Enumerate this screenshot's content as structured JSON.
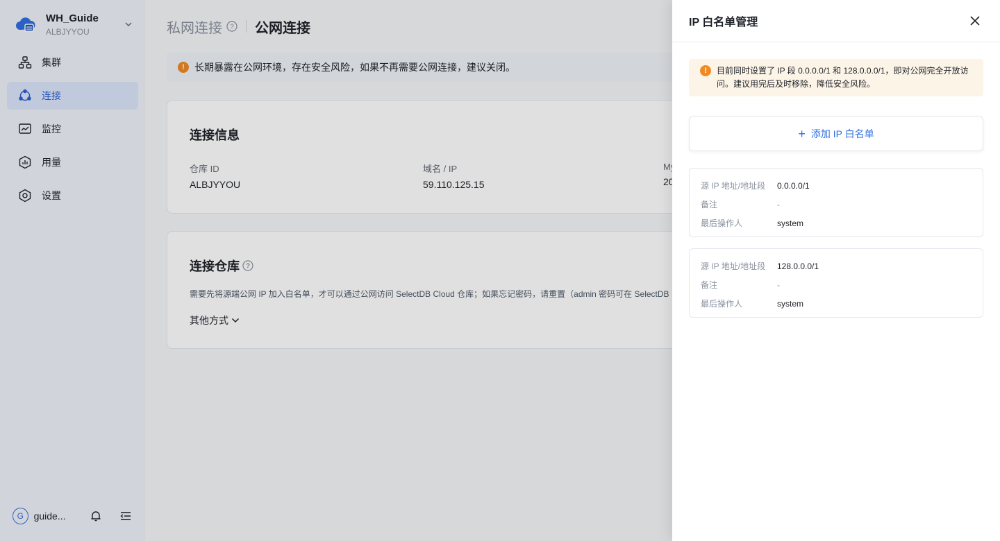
{
  "org": {
    "name": "WH_Guide",
    "id": "ALBJYYOU"
  },
  "nav": [
    {
      "label": "集群",
      "icon": "cluster-icon",
      "active": false
    },
    {
      "label": "连接",
      "icon": "connection-icon",
      "active": true
    },
    {
      "label": "监控",
      "icon": "monitor-icon",
      "active": false
    },
    {
      "label": "用量",
      "icon": "usage-icon",
      "active": false
    },
    {
      "label": "设置",
      "icon": "settings-icon",
      "active": false
    }
  ],
  "user": {
    "initial": "G",
    "name": "guide..."
  },
  "tabs": {
    "private": "私网连接",
    "public": "公网连接"
  },
  "alert": "长期暴露在公网环境，存在安全风险，如果不再需要公网连接，建议关闭。",
  "info_card": {
    "title": "连接信息",
    "fields": [
      {
        "label": "仓库 ID",
        "value": "ALBJYYOU"
      },
      {
        "label": "域名 / IP",
        "value": "59.110.125.15"
      },
      {
        "label": "My",
        "value": "20"
      }
    ]
  },
  "conn_card": {
    "title": "连接仓库",
    "desc": "需要先将源端公网 IP 加入白名单，才可以通过公网访问 SelectDB Cloud 仓库；如果忘记密码，请重置（admin 密码可在 SelectDB",
    "other": "其他方式"
  },
  "drawer": {
    "title": "IP 白名单管理",
    "warning": "目前同时设置了 IP 段 0.0.0.0/1 和 128.0.0.0/1，即对公网完全开放访问。建议用完后及时移除，降低安全风险。",
    "add_label": "添加 IP 白名单",
    "entries": [
      {
        "src_label": "源 IP 地址/地址段",
        "src": "0.0.0.0/1",
        "note_label": "备注",
        "note": "-",
        "op_label": "最后操作人",
        "op": "system"
      },
      {
        "src_label": "源 IP 地址/地址段",
        "src": "128.0.0.0/1",
        "note_label": "备注",
        "note": "-",
        "op_label": "最后操作人",
        "op": "system"
      }
    ]
  },
  "colors": {
    "accent": "#2f6fe0",
    "warning": "#f08a24",
    "active_bg": "#dbe6fb"
  }
}
